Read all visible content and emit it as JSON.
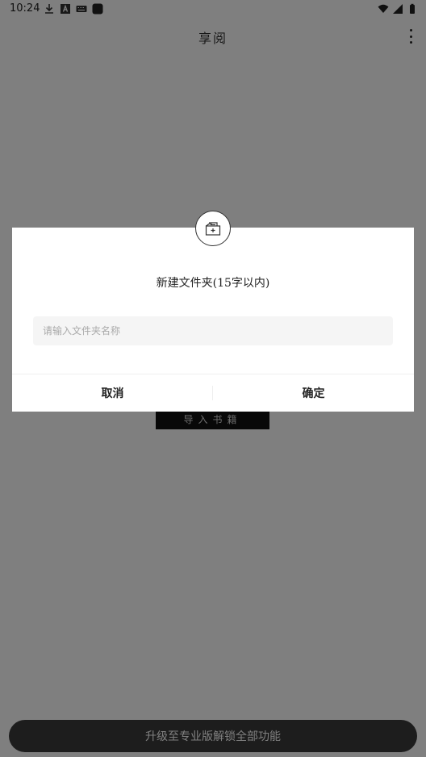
{
  "status_bar": {
    "time": "10:24",
    "icons_left": [
      "download-icon",
      "a-badge-icon",
      "keyboard-icon",
      "square-app-icon"
    ],
    "icons_right": [
      "wifi-icon",
      "signal-icon",
      "battery-icon"
    ]
  },
  "header": {
    "title": "享阅",
    "menu_icon": "more-vertical-icon"
  },
  "main": {
    "import_label": "导入书籍"
  },
  "footer": {
    "upgrade_label": "升级至专业版解锁全部功能"
  },
  "dialog": {
    "icon": "new-folder-icon",
    "title": "新建文件夹(15字以内)",
    "input": {
      "value": "",
      "placeholder": "请输入文件夹名称"
    },
    "cancel_label": "取消",
    "confirm_label": "确定"
  },
  "colors": {
    "overlay": "#000000",
    "dialog_bg": "#ffffff",
    "button_dark": "#111111",
    "input_bg": "#f5f5f5"
  }
}
